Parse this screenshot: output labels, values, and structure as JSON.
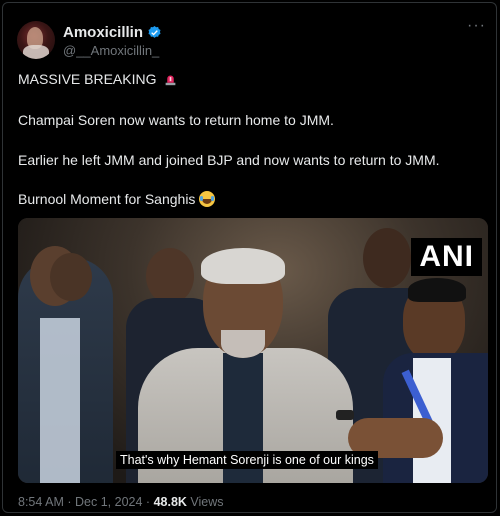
{
  "author": {
    "display_name": "Amoxicillin",
    "handle": "@__Amoxicillin_"
  },
  "post": {
    "line1": "MASSIVE BREAKING",
    "line2": "Champai Soren now wants to return home to JMM.",
    "line3": "Earlier he left JMM and joined BJP and now wants to return to JMM.",
    "line4": "Burnool Moment for Sanghis"
  },
  "media": {
    "watermark": "ANI",
    "caption": "That's why Hemant Sorenji is one of our kings"
  },
  "footer": {
    "time": "8:54 AM",
    "separator": "·",
    "date": "Dec 1, 2024",
    "separator2": "·",
    "views_count": "48.8K",
    "views_label": "Views"
  },
  "icons": {
    "verified": "verified-badge-icon",
    "more": "more-options-icon",
    "siren": "rotating-light-emoji",
    "laugh": "tears-of-joy-emoji"
  },
  "colors": {
    "background": "#000000",
    "text": "#e7e9ea",
    "secondary": "#71767b",
    "verified": "#1d9bf0"
  }
}
